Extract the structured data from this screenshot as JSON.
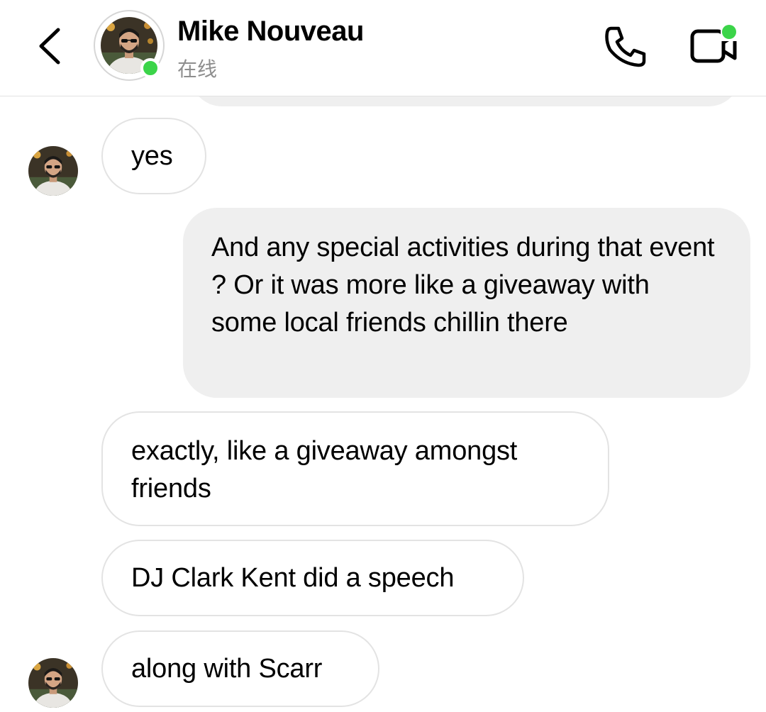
{
  "header": {
    "back_icon": "chevron-left-icon",
    "contact_name": "Mike Nouveau",
    "contact_status": "在线",
    "online_color": "#3bd449",
    "call_icon": "phone-icon",
    "video_icon": "video-camera-icon"
  },
  "messages": [
    {
      "direction": "incoming",
      "text": "yes",
      "show_avatar": true
    },
    {
      "direction": "outgoing",
      "text": "And any special activities during that event ? Or it was more like a giveaway with some local friends chillin there"
    },
    {
      "direction": "incoming",
      "text": "exactly, like a giveaway amongst friends",
      "show_avatar": false
    },
    {
      "direction": "incoming",
      "text": "DJ Clark Kent did a speech",
      "show_avatar": false
    },
    {
      "direction": "incoming",
      "text": "along with Scarr",
      "show_avatar": true
    }
  ],
  "colors": {
    "outgoing_bubble": "#efefef",
    "incoming_border": "#e3e3e3",
    "status_text": "#8e8e8e"
  }
}
